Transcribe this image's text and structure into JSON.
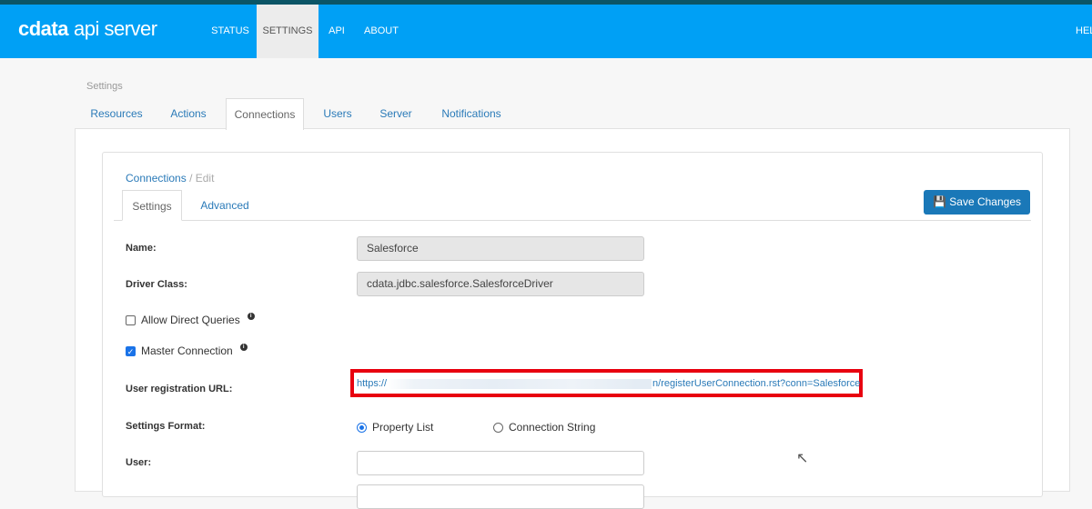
{
  "nav": {
    "logo_brand": "cdata",
    "logo_product": "api server",
    "items": [
      "STATUS",
      "SETTINGS",
      "API",
      "ABOUT"
    ],
    "right": "HEL"
  },
  "page": {
    "title": "Settings",
    "tabs": [
      "Resources",
      "Actions",
      "Connections",
      "Users",
      "Server",
      "Notifications"
    ]
  },
  "breadcrumb": {
    "parent": "Connections",
    "sep": "/",
    "current": "Edit"
  },
  "subtabs": [
    "Settings",
    "Advanced"
  ],
  "save_label": "Save Changes",
  "form": {
    "name_label": "Name:",
    "name_value": "Salesforce",
    "driver_label": "Driver Class:",
    "driver_value": "cdata.jdbc.salesforce.SalesforceDriver",
    "allow_direct": "Allow Direct Queries",
    "master": "Master Connection",
    "url_label": "User registration URL:",
    "url_prefix": "https://",
    "url_suffix": "n/registerUserConnection.rst?conn=Salesforce",
    "format_label": "Settings Format:",
    "format_options": [
      "Property List",
      "Connection String"
    ],
    "user_label": "User:"
  }
}
